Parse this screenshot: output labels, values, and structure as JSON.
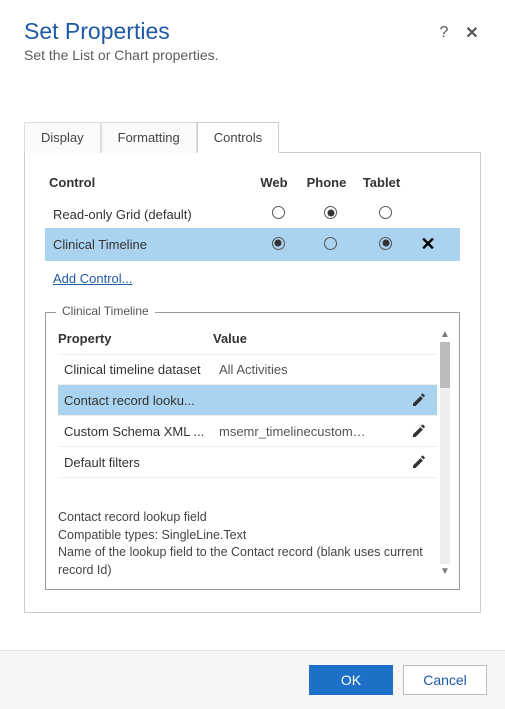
{
  "header": {
    "title": "Set Properties",
    "subtitle": "Set the List or Chart properties."
  },
  "tabs": {
    "display": "Display",
    "formatting": "Formatting",
    "controls": "Controls"
  },
  "controlGrid": {
    "headers": {
      "control": "Control",
      "web": "Web",
      "phone": "Phone",
      "tablet": "Tablet"
    },
    "rows": [
      {
        "name": "Read-only Grid (default)",
        "web": false,
        "phone": true,
        "tablet": false
      },
      {
        "name": "Clinical Timeline",
        "web": true,
        "phone": false,
        "tablet": true
      }
    ],
    "addLabel": "Add Control..."
  },
  "detail": {
    "legend": "Clinical Timeline",
    "headers": {
      "property": "Property",
      "value": "Value"
    },
    "rows": [
      {
        "name": "Clinical timeline dataset",
        "value": "All Activities",
        "edit": false
      },
      {
        "name": "Contact record looku...",
        "value": "",
        "edit": true,
        "selected": true
      },
      {
        "name": "Custom Schema XML ...",
        "value": "msemr_timelinecustomsche...",
        "edit": true
      },
      {
        "name": "Default filters",
        "value": "",
        "edit": true
      }
    ],
    "desc": {
      "line1": "Contact record lookup field",
      "line2": "Compatible types: SingleLine.Text",
      "line3": "Name of the lookup field to the Contact record (blank uses current record Id)"
    }
  },
  "footer": {
    "ok": "OK",
    "cancel": "Cancel"
  }
}
